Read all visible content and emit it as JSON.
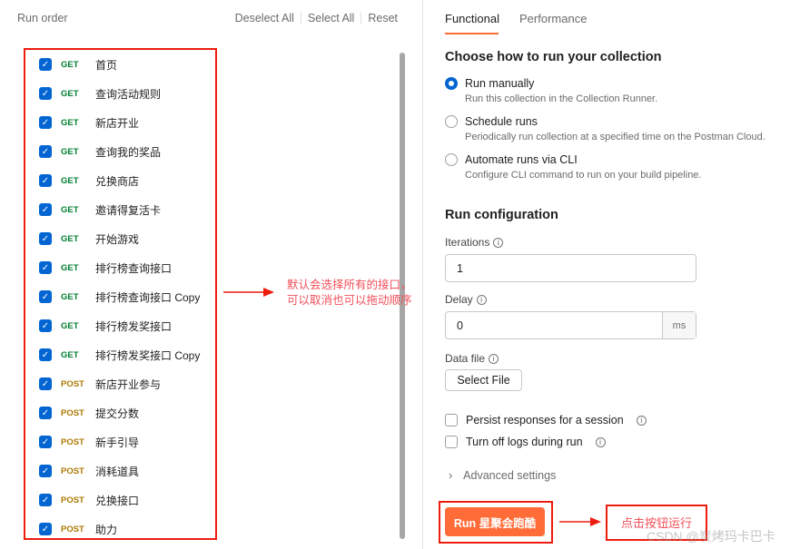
{
  "run_order": {
    "title": "Run order",
    "deselect_all": "Deselect All",
    "select_all": "Select All",
    "reset": "Reset",
    "items": [
      {
        "method": "GET",
        "name": "首页",
        "checked": true
      },
      {
        "method": "GET",
        "name": "查询活动规则",
        "checked": true
      },
      {
        "method": "GET",
        "name": "新店开业",
        "checked": true
      },
      {
        "method": "GET",
        "name": "查询我的奖品",
        "checked": true
      },
      {
        "method": "GET",
        "name": "兑换商店",
        "checked": true
      },
      {
        "method": "GET",
        "name": "邀请得复活卡",
        "checked": true
      },
      {
        "method": "GET",
        "name": "开始游戏",
        "checked": true
      },
      {
        "method": "GET",
        "name": "排行榜查询接口",
        "checked": true
      },
      {
        "method": "GET",
        "name": "排行榜查询接口 Copy",
        "checked": true
      },
      {
        "method": "GET",
        "name": "排行榜发奖接口",
        "checked": true
      },
      {
        "method": "GET",
        "name": "排行榜发奖接口 Copy",
        "checked": true
      },
      {
        "method": "POST",
        "name": "新店开业参与",
        "checked": true
      },
      {
        "method": "POST",
        "name": "提交分数",
        "checked": true
      },
      {
        "method": "POST",
        "name": "新手引导",
        "checked": true
      },
      {
        "method": "POST",
        "name": "消耗道具",
        "checked": true
      },
      {
        "method": "POST",
        "name": "兑换接口",
        "checked": true
      },
      {
        "method": "POST",
        "name": "助力",
        "checked": true
      }
    ]
  },
  "annotations": {
    "left_note_line1": "默认会选择所有的接口，",
    "left_note_line2": "可以取消也可以拖动顺序",
    "right_note": "点击按钮运行",
    "watermark": "CSDN @炭烤玛卡巴卡"
  },
  "tabs": [
    {
      "label": "Functional",
      "active": true
    },
    {
      "label": "Performance",
      "active": false
    }
  ],
  "choose": {
    "title": "Choose how to run your collection",
    "options": [
      {
        "label": "Run manually",
        "desc": "Run this collection in the Collection Runner.",
        "selected": true
      },
      {
        "label": "Schedule runs",
        "desc": "Periodically run collection at a specified time on the Postman Cloud.",
        "selected": false
      },
      {
        "label": "Automate runs via CLI",
        "desc": "Configure CLI command to run on your build pipeline.",
        "selected": false
      }
    ]
  },
  "config": {
    "title": "Run configuration",
    "iterations_label": "Iterations",
    "iterations_value": "1",
    "delay_label": "Delay",
    "delay_value": "0",
    "delay_unit": "ms",
    "data_file_label": "Data file",
    "select_file": "Select File",
    "persist_label": "Persist responses for a session",
    "turn_off_logs_label": "Turn off logs during run",
    "advanced": "Advanced settings",
    "run_button": "Run 星聚会跑酷"
  },
  "colors": {
    "accent": "#ff6c37",
    "checkbox": "#0265d2",
    "get": "#007f31",
    "post": "#ad7a03",
    "annotation": "#ee1c0f"
  }
}
